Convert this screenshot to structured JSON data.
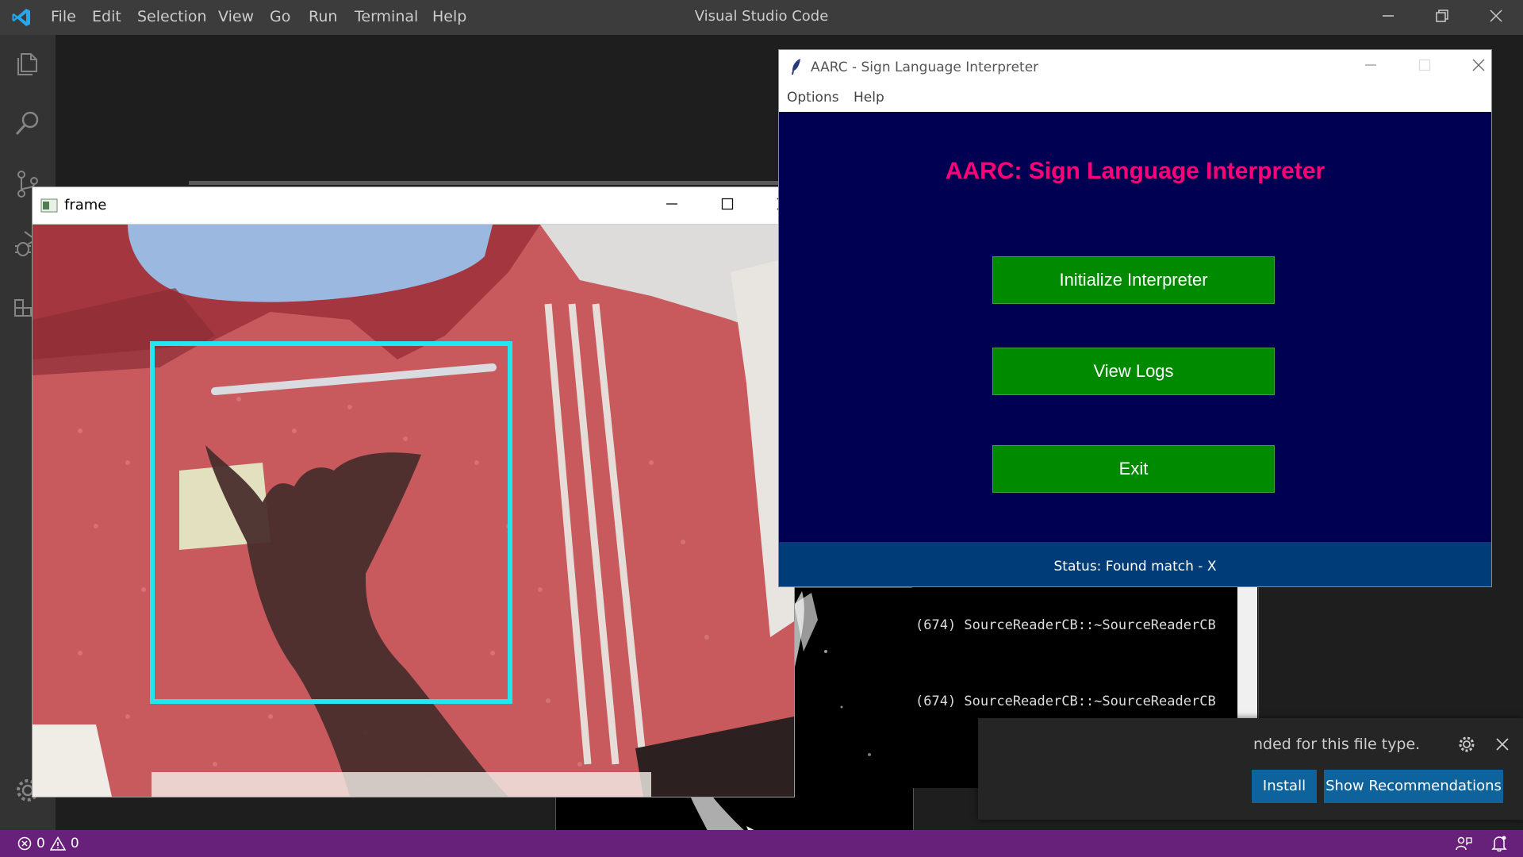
{
  "app": {
    "window_title": "Visual Studio Code",
    "menu": [
      "File",
      "Edit",
      "Selection",
      "View",
      "Go",
      "Run",
      "Terminal",
      "Help"
    ]
  },
  "activity_bar": {
    "icons": [
      "explorer-icon",
      "search-icon",
      "source-control-icon",
      "debug-icon",
      "extensions-icon"
    ],
    "bottom_icon": "gear-icon"
  },
  "status_bar": {
    "errors": "0",
    "warnings": "0",
    "color": "#68217a"
  },
  "frame_window": {
    "title": "frame",
    "detection_box_color": "#22e6f2"
  },
  "aarc_window": {
    "title": "AARC - Sign Language Interpreter",
    "menu": [
      "Options",
      "Help"
    ],
    "heading": "AARC: Sign Language Interpreter",
    "buttons": [
      "Initialize Interpreter",
      "View Logs",
      "Exit"
    ],
    "status": "Status: Found match - X",
    "colors": {
      "background": "#000052",
      "heading": "#ff0077",
      "button": "#008a00",
      "status_bar": "#003c78"
    }
  },
  "console": {
    "lines": [
      "(674) SourceReaderCB::~SourceReaderCB",
      "(674) SourceReaderCB::~SourceReaderCB"
    ]
  },
  "notification": {
    "message": "nded for this file type.",
    "install_label": "Install",
    "recommend_label": "Show Recommendations"
  }
}
